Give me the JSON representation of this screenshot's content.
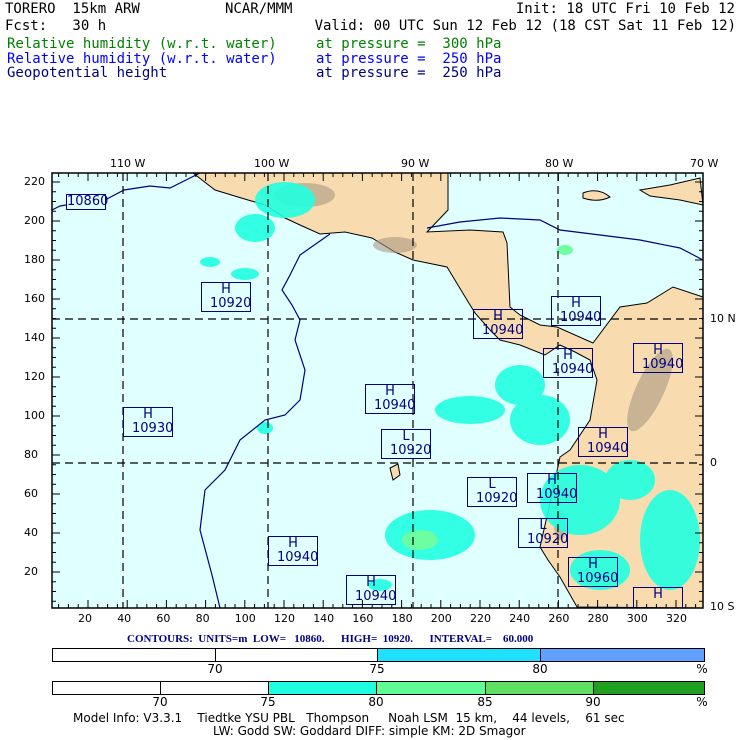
{
  "header": {
    "model": "TORERO  15km ARW",
    "org": "NCAR/MMM",
    "init": "Init: 18 UTC Fri 10 Feb 12",
    "fcst": "Fcst:   30 h",
    "valid": "Valid: 00 UTC Sun 12 Feb 12 (18 CST Sat 11 Feb 12)",
    "fields": [
      {
        "name": "Relative humidity (w.r.t. water)",
        "level": "at pressure =  300 hPa",
        "color": "#008000"
      },
      {
        "name": "Relative humidity (w.r.t. water)",
        "level": "at pressure =  250 hPa",
        "color": "#0000ff"
      },
      {
        "name": "Geopotential height",
        "level": "at pressure =  250 hPa",
        "color": "#000080"
      }
    ]
  },
  "map": {
    "top_labels": [
      "110 W",
      "100 W",
      "90 W",
      "80 W",
      "70 W"
    ],
    "right_labels": [
      "10 N",
      "0",
      "10 S"
    ],
    "x_ticks": [
      20,
      40,
      60,
      80,
      100,
      120,
      140,
      160,
      180,
      200,
      220,
      240,
      260,
      280,
      300,
      320
    ],
    "y_ticks": [
      20,
      40,
      60,
      80,
      100,
      120,
      140,
      160,
      180,
      200,
      220
    ],
    "land_color": "#f8dcb0",
    "ocean_color": "#e0ffff",
    "contour_color": "#000080",
    "centers": [
      {
        "type": "",
        "value": "10860"
      },
      {
        "type": "H",
        "value": "10920"
      },
      {
        "type": "H",
        "value": "10930"
      },
      {
        "type": "H",
        "value": "10940"
      },
      {
        "type": "H",
        "value": "10940"
      },
      {
        "type": "H",
        "value": "10940"
      },
      {
        "type": "H",
        "value": "10940"
      },
      {
        "type": "H",
        "value": "10940"
      },
      {
        "type": "L",
        "value": "10920"
      },
      {
        "type": "H",
        "value": "10940"
      },
      {
        "type": "L",
        "value": "10920"
      },
      {
        "type": "H",
        "value": "10940"
      },
      {
        "type": "L",
        "value": "10920"
      },
      {
        "type": "H",
        "value": "10940"
      },
      {
        "type": "H",
        "value": "10960"
      },
      {
        "type": "H",
        "value": "10940"
      },
      {
        "type": "H",
        "value": ""
      }
    ]
  },
  "contours_line": "CONTOURS:  UNITS=m  LOW=   10860.      HIGH=  10920.      INTERVAL=    60.000",
  "colorbar_250": {
    "labels": [
      "70",
      "75",
      "80",
      "%"
    ],
    "colors": [
      "#ffffff",
      "#ffffff",
      "#20e0ff",
      "#60a0ff"
    ]
  },
  "colorbar_300": {
    "labels": [
      "70",
      "75",
      "80",
      "85",
      "90",
      "%"
    ],
    "colors": [
      "#ffffff",
      "#ffffff",
      "#20ffe0",
      "#60ff98",
      "#60e060",
      "#20a020"
    ]
  },
  "footer": {
    "line1": "Model Info: V3.3.1    Tiedtke YSU PBL   Thompson     Noah LSM  15 km,    44 levels,    61 sec",
    "line2": "LW: Godd SW: Goddard DIFF: simple KM: 2D Smagor"
  }
}
